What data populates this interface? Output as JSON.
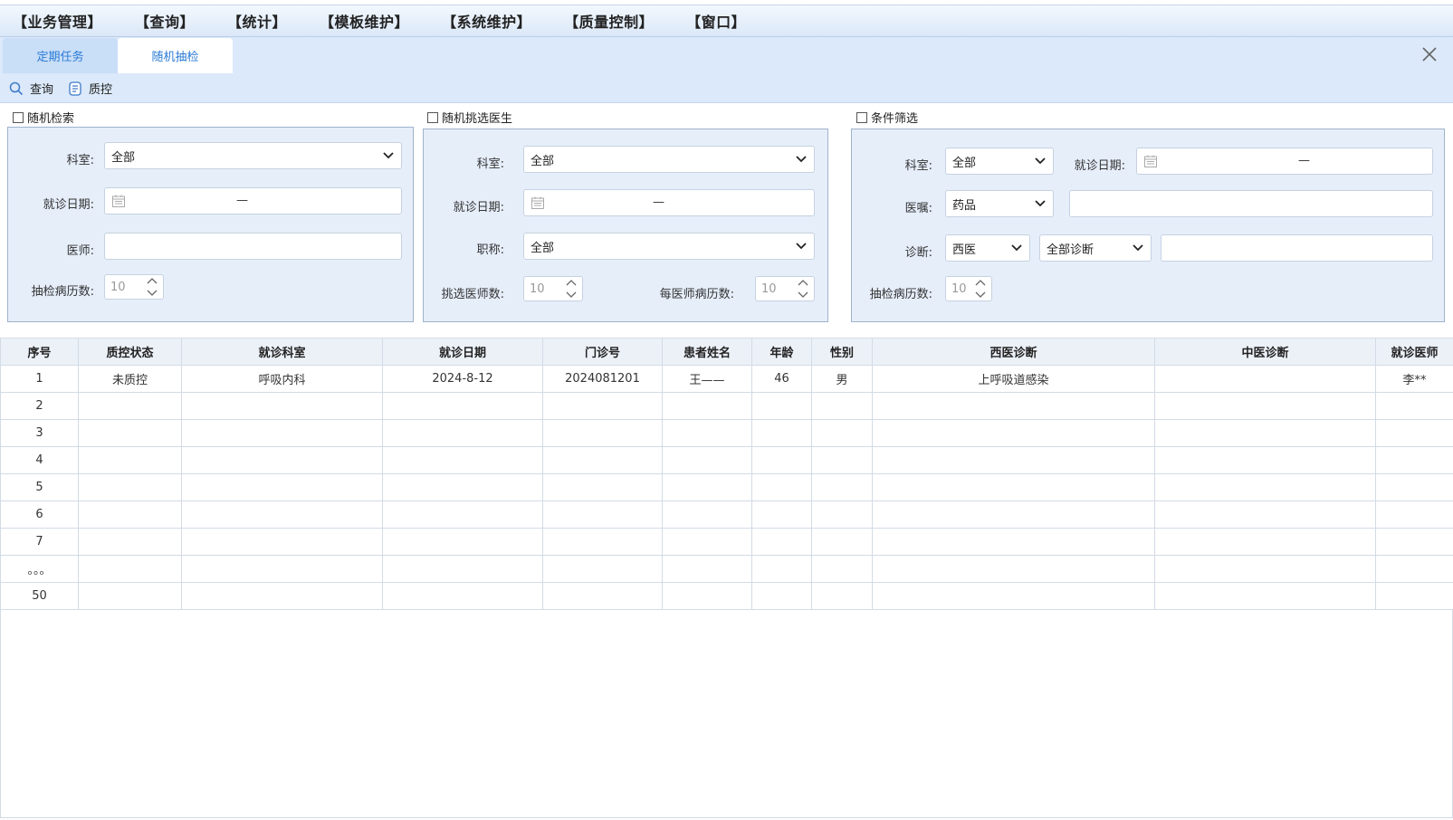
{
  "menu": [
    "【业务管理】",
    "【查询】",
    "【统计】",
    "【模板维护】",
    "【系统维护】",
    "【质量控制】",
    "【窗口】"
  ],
  "tabs": [
    {
      "label": "定期任务",
      "active": false
    },
    {
      "label": "随机抽检",
      "active": true
    }
  ],
  "toolbar": {
    "query_label": "查询",
    "qc_label": "质控"
  },
  "random_search": {
    "title": "随机检索",
    "dept_label": "科室:",
    "dept_value": "全部",
    "date_label": "就诊日期:",
    "date_sep": "—",
    "doctor_label": "医师:",
    "doctor_value": "",
    "count_label": "抽检病历数:",
    "count_value": "10"
  },
  "random_doctor": {
    "title": "随机挑选医生",
    "dept_label": "科室:",
    "dept_value": "全部",
    "date_label": "就诊日期:",
    "date_sep": "—",
    "title_label": "职称:",
    "title_value": "全部",
    "doctor_count_label": "挑选医师数:",
    "doctor_count_value": "10",
    "per_doctor_label": "每医师病历数:",
    "per_doctor_value": "10"
  },
  "condition_filter": {
    "title": "条件筛选",
    "dept_label": "科室:",
    "dept_value": "全部",
    "date_label": "就诊日期:",
    "date_sep": "—",
    "order_label": "医嘱:",
    "order_value": "药品",
    "order_text": "",
    "diag_label": "诊断:",
    "diag_type_value": "西医",
    "diag_scope_value": "全部诊断",
    "diag_text": "",
    "count_label": "抽检病历数:",
    "count_value": "10"
  },
  "table": {
    "columns": [
      "序号",
      "质控状态",
      "就诊科室",
      "就诊日期",
      "门诊号",
      "患者姓名",
      "年龄",
      "性别",
      "西医诊断",
      "中医诊断",
      "就诊医师"
    ],
    "rows": [
      [
        "1",
        "未质控",
        "呼吸内科",
        "2024-8-12",
        "2024081201",
        "王——",
        "46",
        "男",
        "上呼吸道感染",
        "",
        "李**"
      ],
      [
        "2",
        "",
        "",
        "",
        "",
        "",
        "",
        "",
        "",
        "",
        ""
      ],
      [
        "3",
        "",
        "",
        "",
        "",
        "",
        "",
        "",
        "",
        "",
        ""
      ],
      [
        "4",
        "",
        "",
        "",
        "",
        "",
        "",
        "",
        "",
        "",
        ""
      ],
      [
        "5",
        "",
        "",
        "",
        "",
        "",
        "",
        "",
        "",
        "",
        ""
      ],
      [
        "6",
        "",
        "",
        "",
        "",
        "",
        "",
        "",
        "",
        "",
        ""
      ],
      [
        "7",
        "",
        "",
        "",
        "",
        "",
        "",
        "",
        "",
        "",
        ""
      ],
      [
        "。。。",
        "",
        "",
        "",
        "",
        "",
        "",
        "",
        "",
        "",
        ""
      ],
      [
        "50",
        "",
        "",
        "",
        "",
        "",
        "",
        "",
        "",
        "",
        ""
      ]
    ]
  },
  "icons": {
    "close": "close-icon",
    "search": "search-icon",
    "qc": "document-icon",
    "calendar": "calendar-icon",
    "dropdown": "chevron-down-icon"
  }
}
